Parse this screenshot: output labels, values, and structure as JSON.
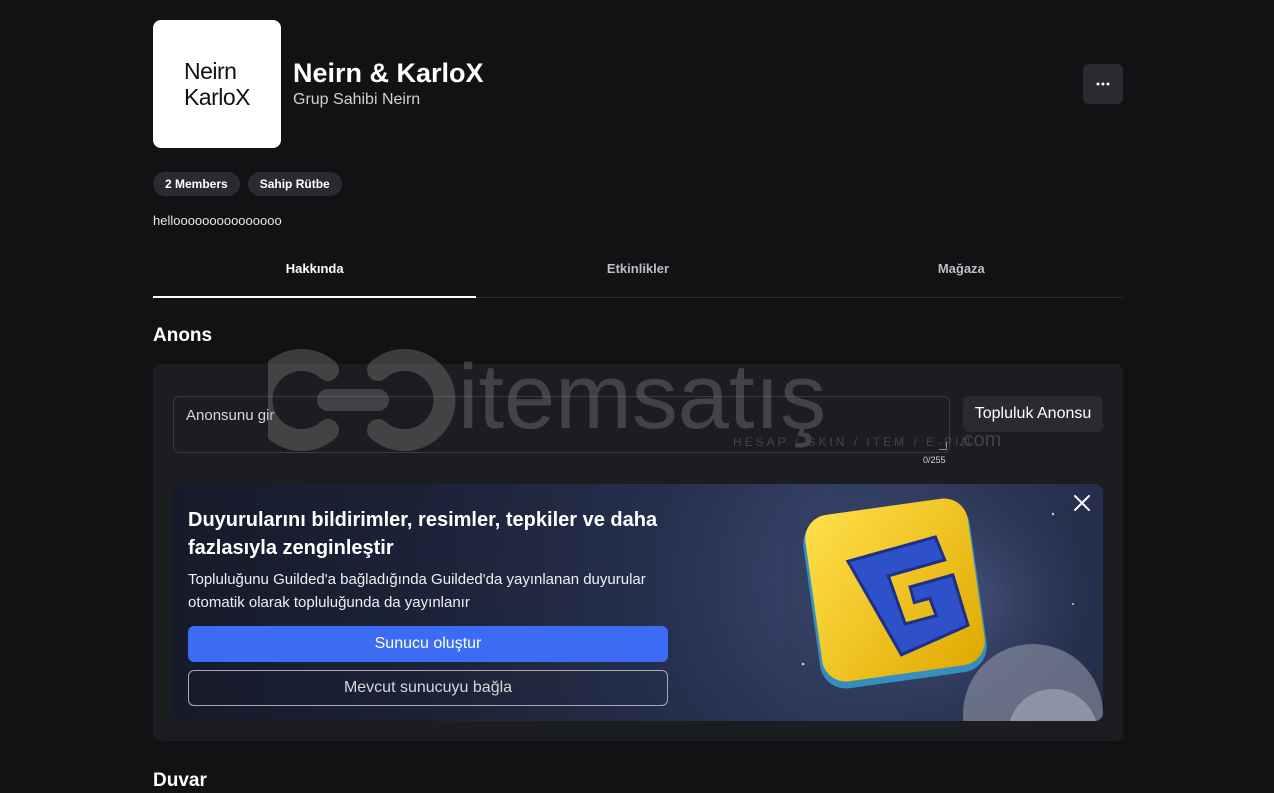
{
  "group": {
    "logo_text": "Neirn\nKarloX",
    "name": "Neirn & KarloX",
    "owner_line": "Grup Sahibi Neirn",
    "more_icon": "ellipsis-icon",
    "badges": [
      "2 Members",
      "Sahip Rütbe"
    ],
    "description": "hellooooooooooooooo"
  },
  "tabs": [
    {
      "label": "Hakkında",
      "active": true
    },
    {
      "label": "Etkinlikler",
      "active": false
    },
    {
      "label": "Mağaza",
      "active": false
    }
  ],
  "announcement": {
    "section_title": "Anons",
    "placeholder": "Anonsunu gir",
    "counter": "0/255",
    "community_button": "Topluluk Anonsu"
  },
  "promo": {
    "title": "Duyurularını bildirimler, resimler, tepkiler ve daha fazlasıyla zenginleştir",
    "subtitle": "Topluluğunu Guilded'a bağladığında Guilded'da yayınlanan duyurular otomatik olarak topluluğunda da yayınlanır",
    "primary_button": "Sunucu oluştur",
    "secondary_button": "Mevcut sunucuyu bağla",
    "close_icon": "close-icon",
    "art_icon": "guilded-logo-icon"
  },
  "wall": {
    "section_title": "Duvar"
  },
  "watermark": {
    "brand": "itemsatış",
    "tagline": "HESAP / SKIN / ITEM / E-PIN",
    "suffix": ".com"
  },
  "colors": {
    "background": "#121215",
    "panel": "#1c1d21",
    "primary": "#3c6cf5",
    "guilded_yellow": "#f5c400"
  }
}
